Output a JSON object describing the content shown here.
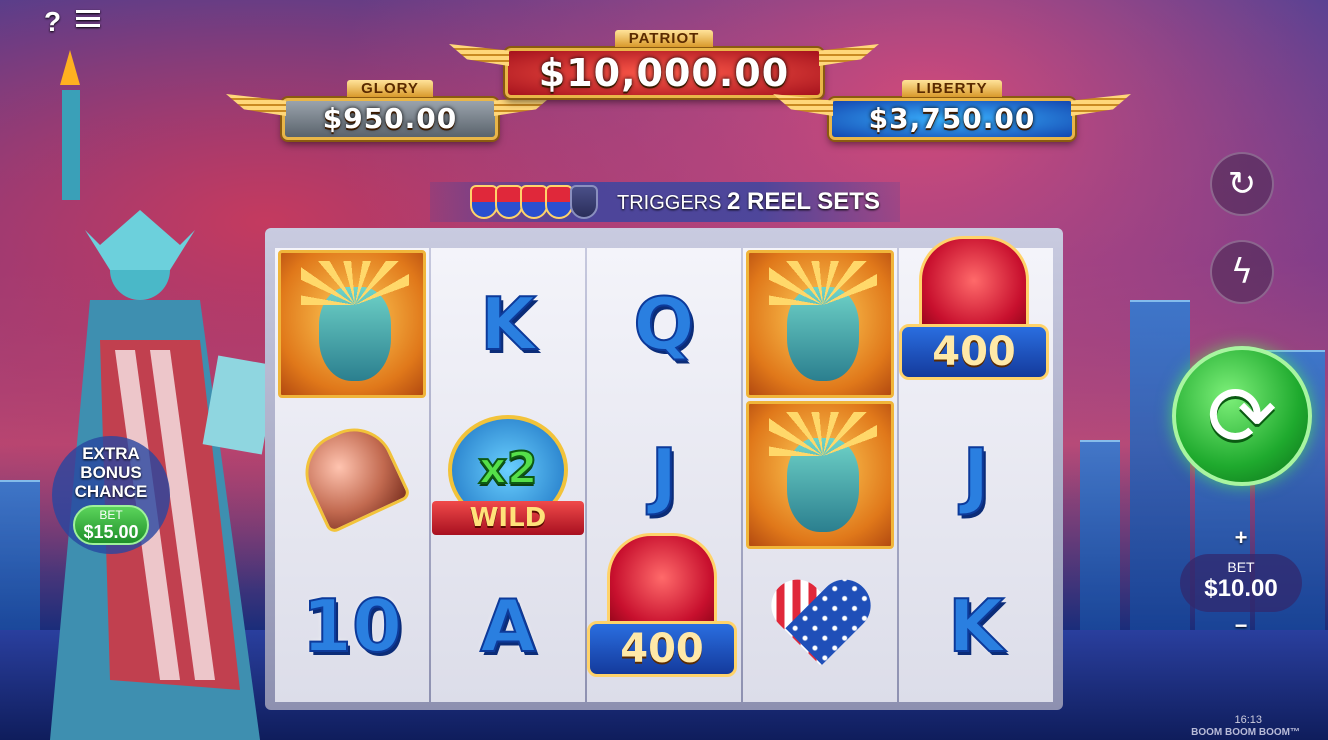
{
  "menu": {
    "help_label": "?",
    "menu_label": "menu"
  },
  "jackpots": {
    "patriot": {
      "name": "PATRIOT",
      "amount": "$10,000.00"
    },
    "glory": {
      "name": "GLORY",
      "amount": "$950.00"
    },
    "liberty": {
      "name": "LIBERTY",
      "amount": "$3,750.00"
    }
  },
  "triggers": {
    "prefix": "TRIGGERS",
    "emphasis": "2 REEL SETS",
    "badge_count": 5,
    "lit_badges": 4
  },
  "reels": [
    {
      "cells": [
        {
          "symbol": "liberty-symbol"
        },
        {
          "symbol": "bell-symbol"
        },
        {
          "symbol": "10"
        }
      ]
    },
    {
      "cells": [
        {
          "symbol": "K"
        },
        {
          "symbol": "x2-wild-symbol",
          "top": "x2",
          "label": "WILD"
        },
        {
          "symbol": "A"
        }
      ]
    },
    {
      "cells": [
        {
          "symbol": "Q"
        },
        {
          "symbol": "J"
        },
        {
          "symbol": "firework-symbol",
          "value": "400"
        }
      ]
    },
    {
      "cells": [
        {
          "symbol": "liberty-symbol"
        },
        {
          "symbol": "liberty-symbol"
        },
        {
          "symbol": "heart-symbol"
        }
      ]
    },
    {
      "cells": [
        {
          "symbol": "firework-symbol",
          "value": "400"
        },
        {
          "symbol": "J"
        },
        {
          "symbol": "K"
        }
      ]
    }
  ],
  "extra_bonus": {
    "title": "EXTRA BONUS CHANCE",
    "bet_label": "BET",
    "bet_value": "$15.00"
  },
  "controls": {
    "autoplay_icon": "autoplay-icon",
    "turbo_icon": "lightning-icon",
    "spin_icon": "spin-icon",
    "bet_label": "BET",
    "bet_value": "$10.00",
    "increase": "+",
    "decrease": "−"
  },
  "footer": {
    "time": "16:13",
    "brand": "BOOM BOOM BOOM™"
  },
  "colors": {
    "spin": "#1faa2e",
    "patriot": "#a5121d",
    "liberty": "#1447b0",
    "glory": "#5a636c",
    "gold": "#e9b648"
  }
}
